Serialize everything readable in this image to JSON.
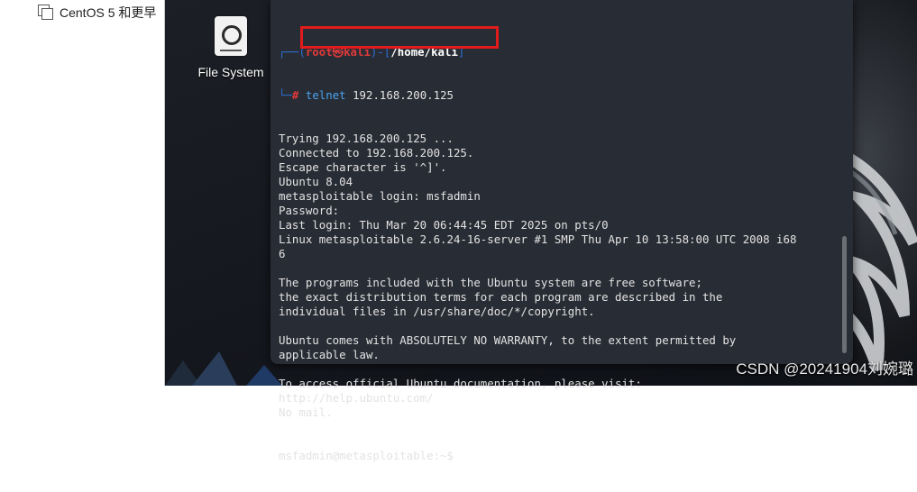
{
  "host_panel": {
    "vm_item_label": "CentOS 5 和更早"
  },
  "desktop": {
    "icon_label": "File System"
  },
  "terminal": {
    "prompt_user": "root㉿kali",
    "prompt_dir": "/home/kali",
    "command": "telnet",
    "command_arg": "192.168.200.125",
    "output": [
      "Trying 192.168.200.125 ...",
      "Connected to 192.168.200.125.",
      "Escape character is '^]'.",
      "Ubuntu 8.04",
      "metasploitable login: msfadmin",
      "Password:",
      "Last login: Thu Mar 20 06:44:45 EDT 2025 on pts/0",
      "Linux metasploitable 2.6.24-16-server #1 SMP Thu Apr 10 13:58:00 UTC 2008 i68",
      "6",
      "",
      "The programs included with the Ubuntu system are free software;",
      "the exact distribution terms for each program are described in the",
      "individual files in /usr/share/doc/*/copyright.",
      "",
      "Ubuntu comes with ABSOLUTELY NO WARRANTY, to the extent permitted by",
      "applicable law.",
      "",
      "To access official Ubuntu documentation, please visit:",
      "http://help.ubuntu.com/",
      "No mail."
    ],
    "final_prompt": "msfadmin@metasploitable:~$ "
  },
  "watermark": "CSDN @20241904刘婉璐",
  "colors": {
    "highlight_border": "#e11b1b",
    "prompt_user": "#e03a3a",
    "command": "#4aa3f0"
  },
  "icons": {
    "vm_item": "copy-icon",
    "desktop": "drive-icon"
  }
}
